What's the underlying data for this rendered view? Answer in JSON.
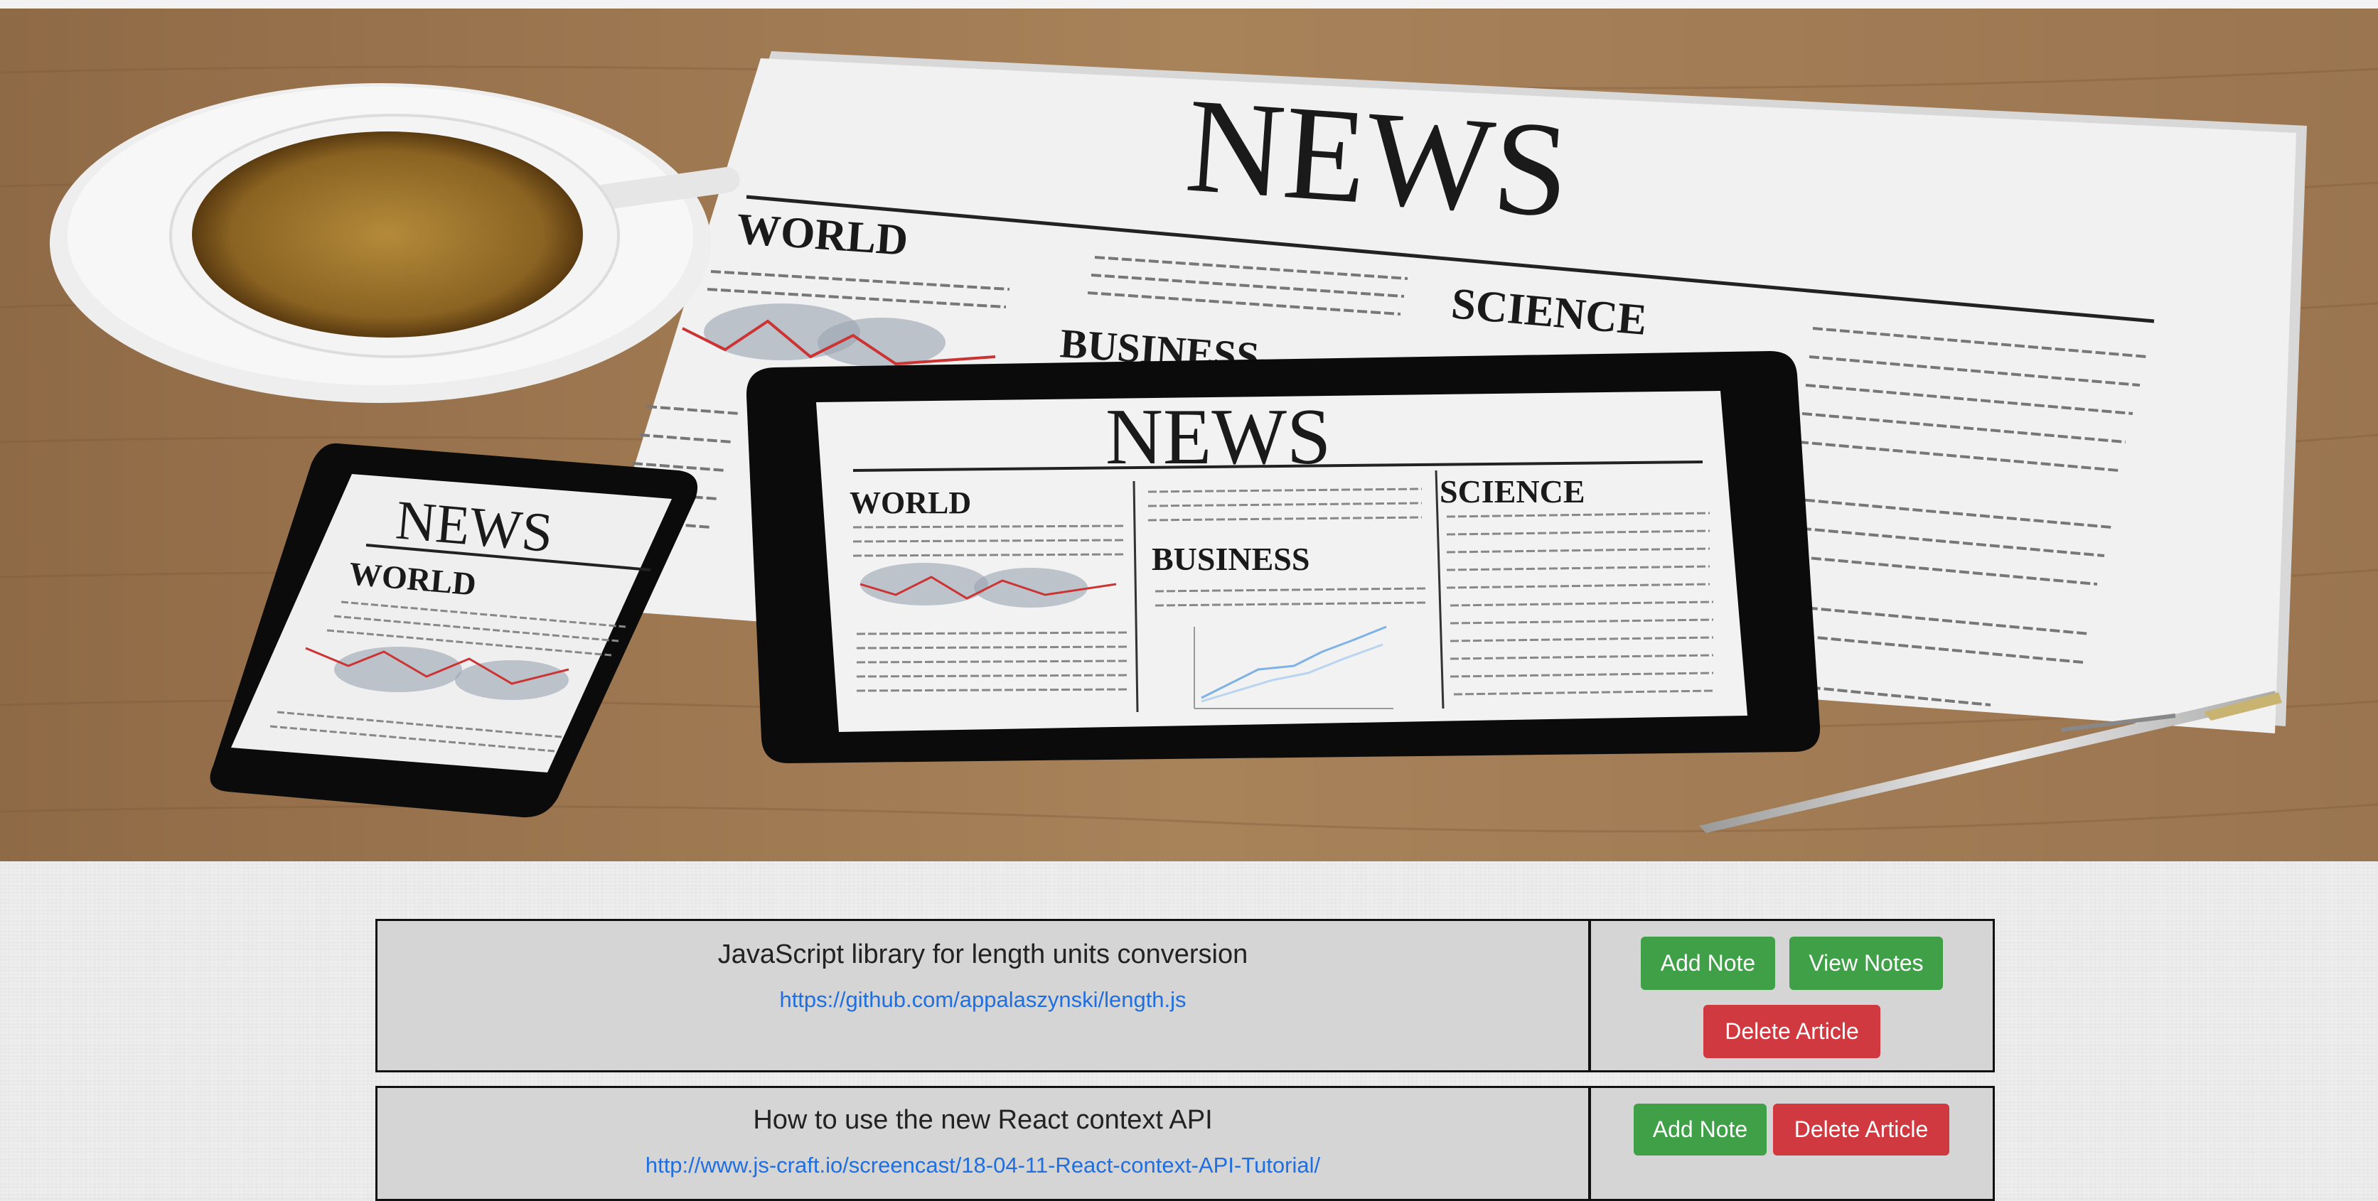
{
  "hero": {
    "newspaper_masthead": "NEWS",
    "newspaper_sections": [
      "WORLD",
      "SCIENCE",
      "BUSINESS"
    ],
    "tablet_masthead": "NEWS",
    "tablet_sections": [
      "WORLD",
      "SCIENCE",
      "BUSINESS"
    ],
    "phone_masthead": "NEWS",
    "phone_section": "WORLD"
  },
  "articles": [
    {
      "title": "JavaScript library for length units conversion",
      "link": "https://github.com/appalaszynski/length.js",
      "buttons": {
        "add_note": "Add Note",
        "view_notes": "View Notes",
        "delete": "Delete Article"
      }
    },
    {
      "title": "How to use the new React context API",
      "link": "http://www.js-craft.io/screencast/18-04-11-React-context-API-Tutorial/",
      "buttons": {
        "add_note": "Add Note",
        "delete": "Delete Article"
      }
    }
  ],
  "colors": {
    "card_background": "#d5d5d5",
    "link_blue": "#1f6fe0",
    "success_green": "#3fa048",
    "danger_red": "#d0393f"
  }
}
